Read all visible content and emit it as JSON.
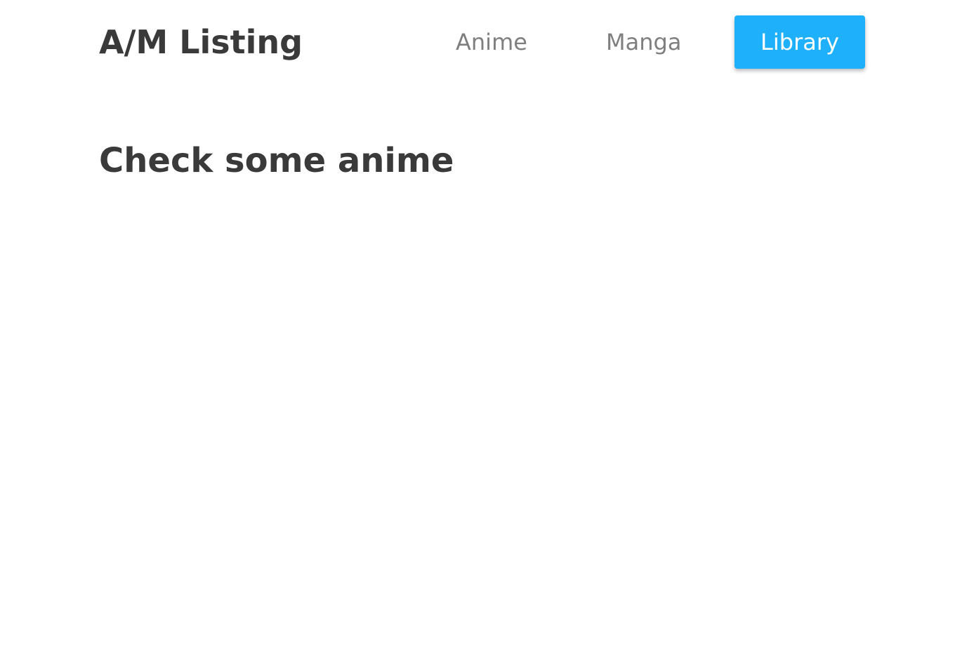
{
  "header": {
    "brand": "A/M Listing",
    "nav": {
      "items": [
        {
          "label": "Anime",
          "active": false
        },
        {
          "label": "Manga",
          "active": false
        },
        {
          "label": "Library",
          "active": true
        }
      ]
    }
  },
  "main": {
    "heading": "Check some anime"
  },
  "colors": {
    "accent": "#1fb0fb",
    "text": "#3a3a3a",
    "nav_text": "#7f7f7f",
    "background": "#ffffff"
  }
}
